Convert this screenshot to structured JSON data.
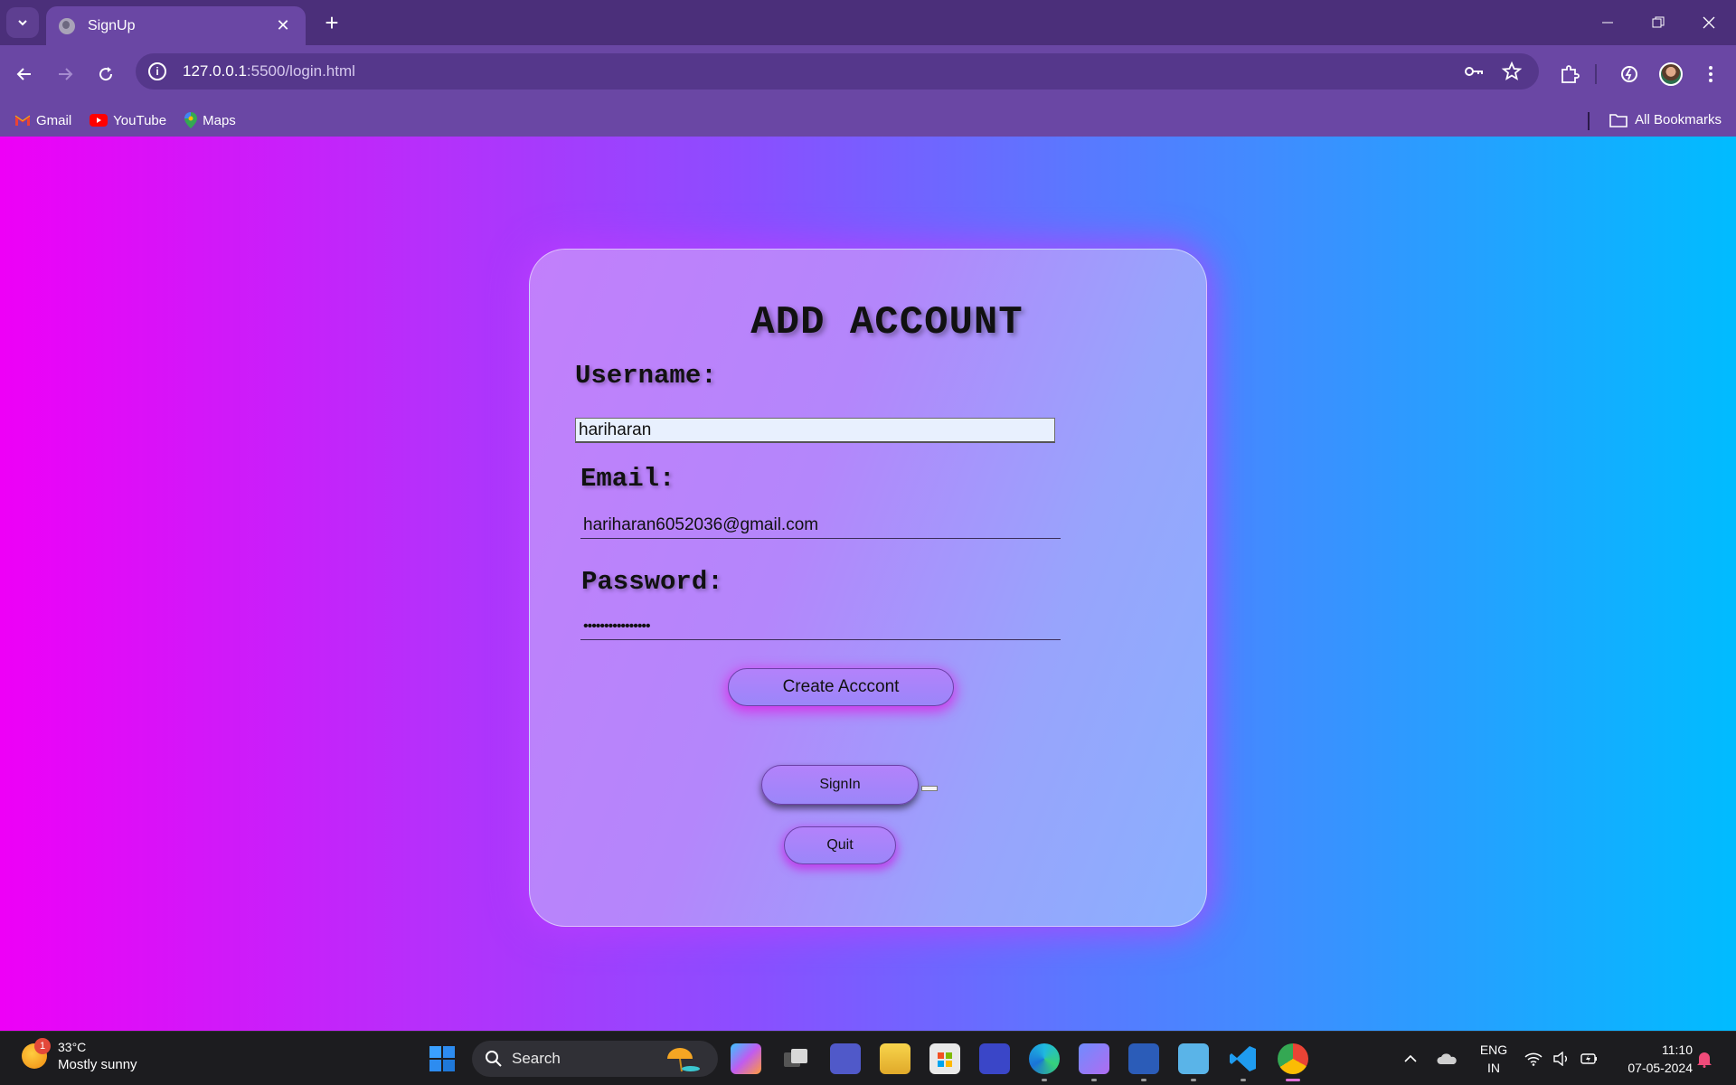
{
  "browser": {
    "tab_title": "SignUp",
    "url_host": "127.0.0.1",
    "url_rest": ":5500/login.html",
    "bookmarks": [
      {
        "label": "Gmail",
        "icon": "gmail-icon"
      },
      {
        "label": "YouTube",
        "icon": "youtube-icon"
      },
      {
        "label": "Maps",
        "icon": "maps-icon"
      }
    ],
    "all_bookmarks_label": "All Bookmarks"
  },
  "form": {
    "title": "ADD ACCOUNT",
    "username_label": "Username:",
    "username_value": "hariharan",
    "email_label": "Email:",
    "email_value": "hariharan6052036@gmail.com",
    "password_label": "Password:",
    "password_value": "••••••••••••••••",
    "create_button": "Create Acccont",
    "signin_button": "SignIn",
    "quit_button": "Quit"
  },
  "taskbar": {
    "weather_badge": "1",
    "temperature": "33°C",
    "weather_desc": "Mostly sunny",
    "search_placeholder": "Search",
    "lang_line1": "ENG",
    "lang_line2": "IN",
    "time": "11:10",
    "date": "07-05-2024"
  },
  "colors": {
    "page_gradient_start": "#ee00f7",
    "page_gradient_end": "#00bcff",
    "browser_frame": "#6a47a4",
    "accent_glow": "#dc1ee6"
  }
}
